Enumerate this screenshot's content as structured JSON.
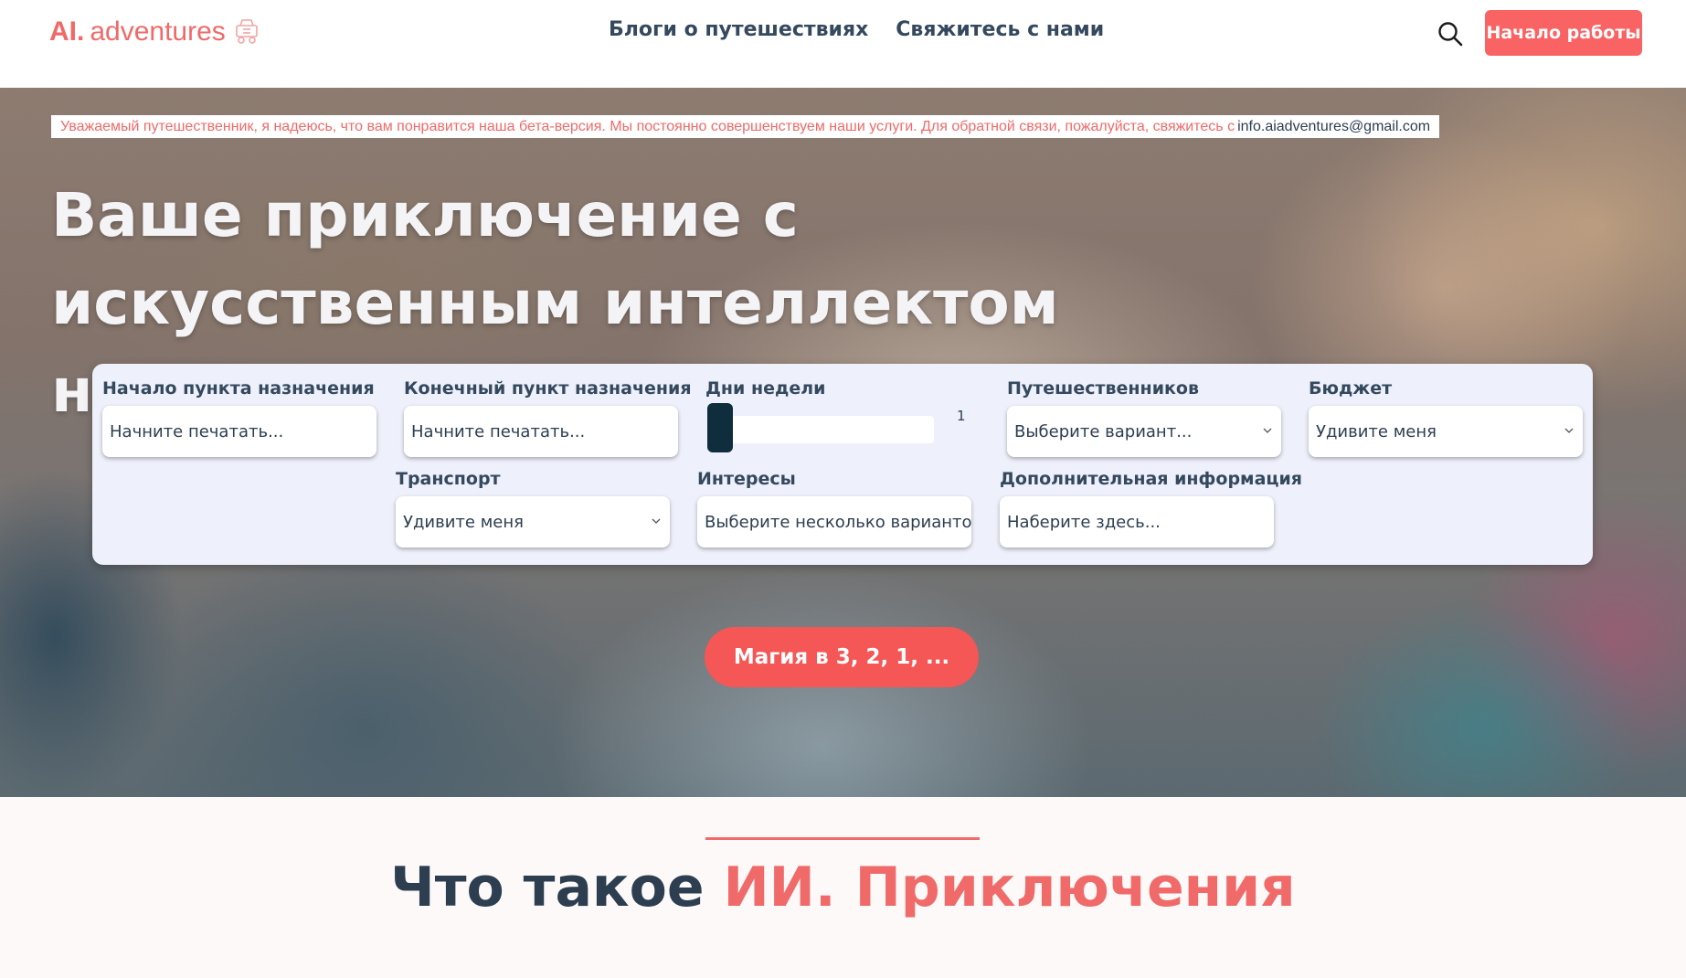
{
  "header": {
    "logo_ai": "AI.",
    "logo_text": "adventures",
    "nav": [
      "Блоги о путешествиях",
      "Свяжитесь с нами"
    ],
    "start_button": "Начало работы"
  },
  "hero": {
    "notice_text": "Уважаемый путешественник, я надеюсь, что вам понравится наша бета-версия. Мы постоянно совершенствуем наши услуги. Для обратной связи, пожалуйста, свяжитесь с",
    "notice_email": "info.aiadventures@gmail.com",
    "title": "Ваше приключение с искусственным интеллектом начинается здесь"
  },
  "form": {
    "start_label": "Начало пункта назначения",
    "start_placeholder": "Начните печатать...",
    "end_label": "Конечный пункт назначения",
    "end_placeholder": "Начните печатать...",
    "days_label": "Дни недели",
    "days_value": 1,
    "days_value_text": "1",
    "travelers_label": "Путешественников",
    "travelers_value": "Выберите вариант...",
    "budget_label": "Бюджет",
    "budget_value": "Удивите меня",
    "transport_label": "Транспорт",
    "transport_value": "Удивите меня",
    "interests_label": "Интересы",
    "interests_value": "Выберите несколько вариантов",
    "extra_label": "Дополнительная информация",
    "extra_placeholder": "Наберите здесь..."
  },
  "magic_button": "Магия в 3, 2, 1, ...",
  "section": {
    "title_dark": "Что такое",
    "title_accent": "ИИ. Приключения"
  },
  "colors": {
    "accent": "#f96363",
    "heading": "#2c3e50",
    "slider_thumb": "#0f2d3c",
    "panel": "#eef0fb"
  },
  "icons": [
    "cart-icon",
    "search-icon",
    "chevron-down-icon"
  ]
}
